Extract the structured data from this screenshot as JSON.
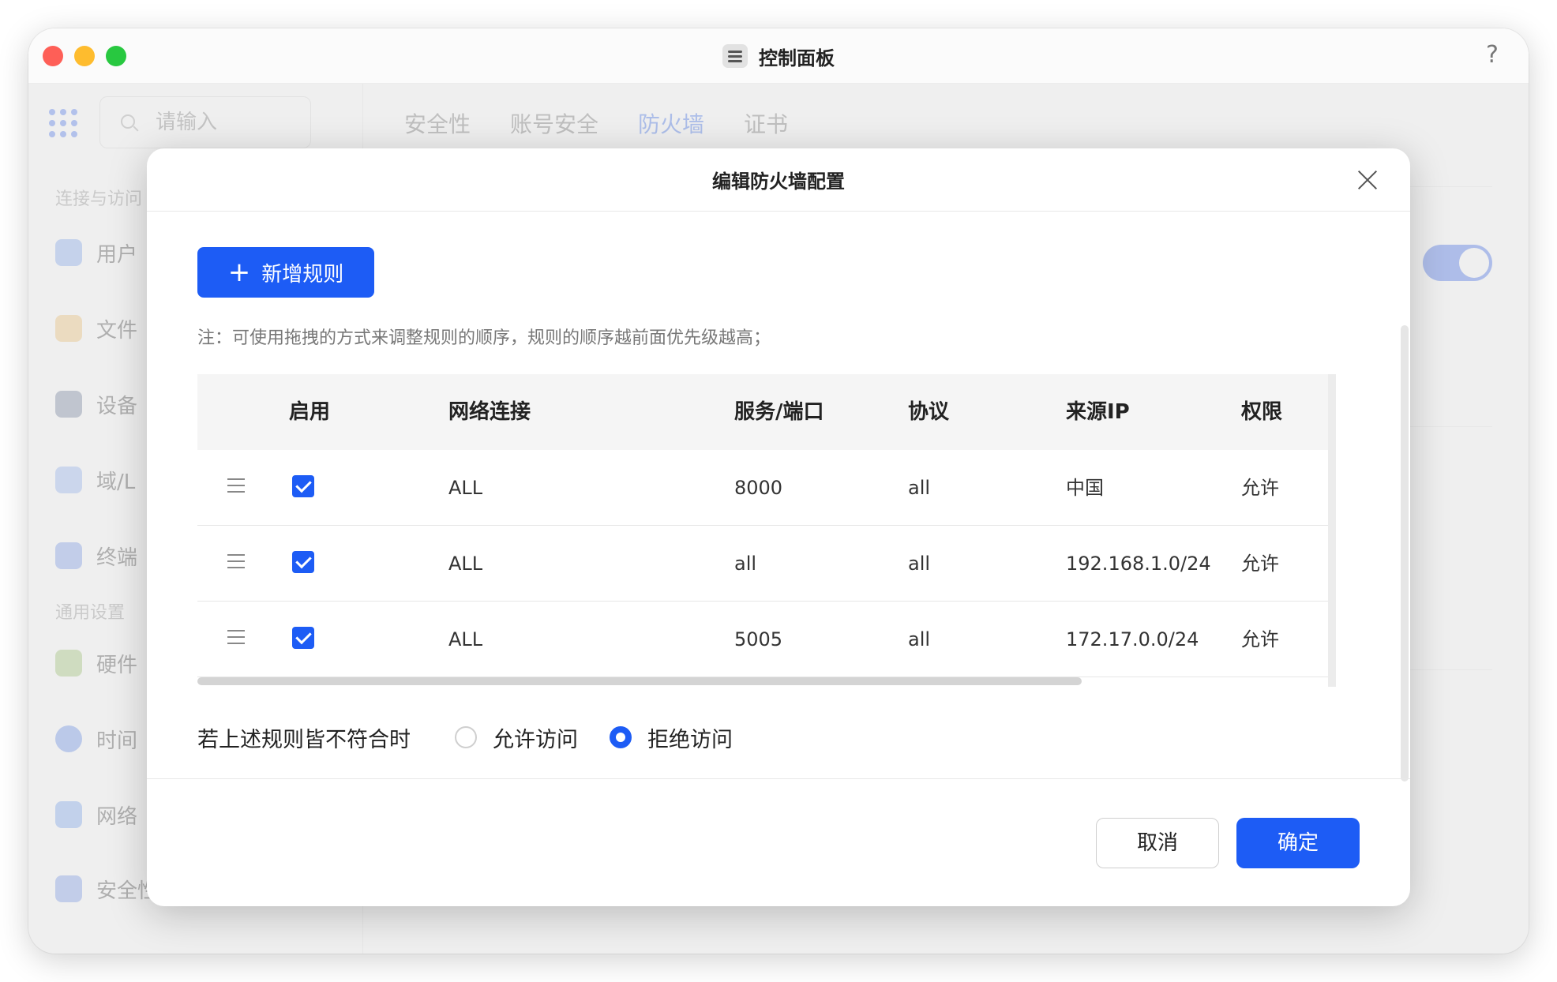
{
  "window": {
    "title": "控制面板",
    "help": "?"
  },
  "background": {
    "search_placeholder": "请输入",
    "sections": [
      "连接与访问",
      "通用设置"
    ],
    "sidebar_items": [
      "用户",
      "文件",
      "设备",
      "域/L",
      "终端",
      "硬件",
      "时间",
      "网络",
      "安全性"
    ],
    "tabs": [
      "安全性",
      "账号安全",
      "防火墙",
      "证书"
    ],
    "active_tab": "防火墙",
    "accent_color": "#2b63f0"
  },
  "modal": {
    "title": "编辑防火墙配置",
    "add_label": "新增规则",
    "note": "注：可使用拖拽的方式来调整规则的顺序，规则的顺序越前面优先级越高；",
    "columns": [
      "启用",
      "网络连接",
      "服务/端口",
      "协议",
      "来源IP",
      "权限"
    ],
    "rows": [
      {
        "enabled": true,
        "network": "ALL",
        "port": "8000",
        "protocol": "all",
        "source": "中国",
        "permission": "允许"
      },
      {
        "enabled": true,
        "network": "ALL",
        "port": "all",
        "protocol": "all",
        "source": "192.168.1.0/24",
        "permission": "允许"
      },
      {
        "enabled": true,
        "network": "ALL",
        "port": "5005",
        "protocol": "all",
        "source": "172.17.0.0/24",
        "permission": "允许"
      }
    ],
    "default_label": "若上述规则皆不符合时",
    "options": [
      "允许访问",
      "拒绝访问"
    ],
    "selected_option": "拒绝访问",
    "cancel_label": "取消",
    "ok_label": "确定",
    "primary_color": "#1d5cf5"
  }
}
